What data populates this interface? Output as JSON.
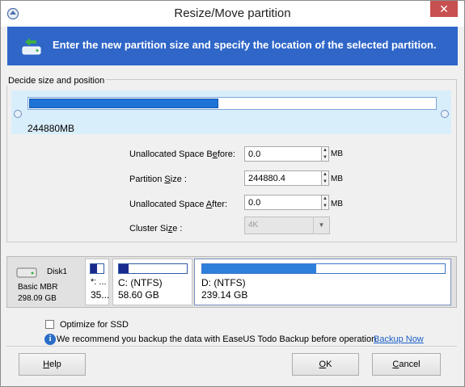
{
  "window": {
    "title": "Resize/Move partition",
    "close": "✕"
  },
  "banner": {
    "text": "Enter the new partition size and specify the location of the selected partition."
  },
  "group": {
    "legend": "Decide size and position"
  },
  "slider": {
    "size_label": "244880MB",
    "fill_fraction": 0.465
  },
  "fields": {
    "before": {
      "label": "Unallocated Space Before:",
      "value": "0.0",
      "unit": "MB"
    },
    "size": {
      "label": "Partition Size :",
      "value": "244880.4",
      "unit": "MB"
    },
    "after": {
      "label": "Unallocated Space After:",
      "value": "0.0",
      "unit": "MB"
    },
    "cluster": {
      "label": "Cluster Size :",
      "value": "4K"
    }
  },
  "disk": {
    "name": "Disk1",
    "type": "Basic MBR",
    "size": "298.09 GB",
    "partitions": [
      {
        "label": "*: ...",
        "size": "35...",
        "fill": 0.5
      },
      {
        "label": "C: (NTFS)",
        "size": "58.60 GB",
        "fill": 0.14
      },
      {
        "label": "D: (NTFS)",
        "size": "239.14 GB",
        "fill": 0.47
      }
    ]
  },
  "options": {
    "ssd_label": "Optimize for SSD",
    "ssd_checked": false,
    "recommend_text": "We recommend you backup the data with EaseUS Todo Backup before operation.",
    "backup_link": "Backup Now"
  },
  "buttons": {
    "help": "Help",
    "ok": "OK",
    "cancel": "Cancel"
  },
  "colors": {
    "accent": "#2f66c8",
    "bar_fill": "#1e73d6",
    "close": "#c75050"
  }
}
